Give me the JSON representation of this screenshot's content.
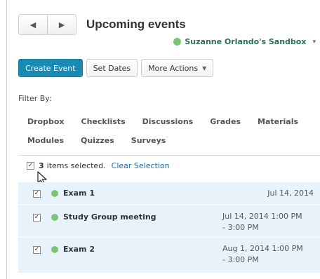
{
  "header": {
    "prev_glyph": "◀",
    "next_glyph": "▶",
    "title": "Upcoming events"
  },
  "org": {
    "name": "Suzanne Orlando's Sandbox",
    "status_color": "#7cc576",
    "caret": "▾"
  },
  "actions": {
    "create_event": "Create Event",
    "set_dates": "Set Dates",
    "more_actions": "More Actions",
    "more_caret": "▼"
  },
  "filter": {
    "label": "Filter By:",
    "options": [
      "Dropbox",
      "Checklists",
      "Discussions",
      "Grades",
      "Materials",
      "Modules",
      "Quizzes",
      "Surveys"
    ]
  },
  "selection": {
    "count": "3",
    "text": "items selected.",
    "clear_label": "Clear Selection",
    "checked": true
  },
  "events": [
    {
      "name": "Exam 1",
      "date_line1": "Jul 14, 2014",
      "date_line2": "",
      "checked": true,
      "chevron": "›"
    },
    {
      "name": "Study Group meeting",
      "date_line1": "Jul 14, 2014 1:00 PM",
      "date_line2": "- 3:00 PM",
      "checked": true,
      "chevron": "›"
    },
    {
      "name": "Exam 2",
      "date_line1": "Aug 1, 2014 1:00 PM",
      "date_line2": "- 3:00 PM",
      "checked": true,
      "chevron": "›"
    }
  ],
  "colors": {
    "accent": "#1a8ab3",
    "row_bg": "#e7f2fb",
    "link": "#1a6fa3"
  }
}
